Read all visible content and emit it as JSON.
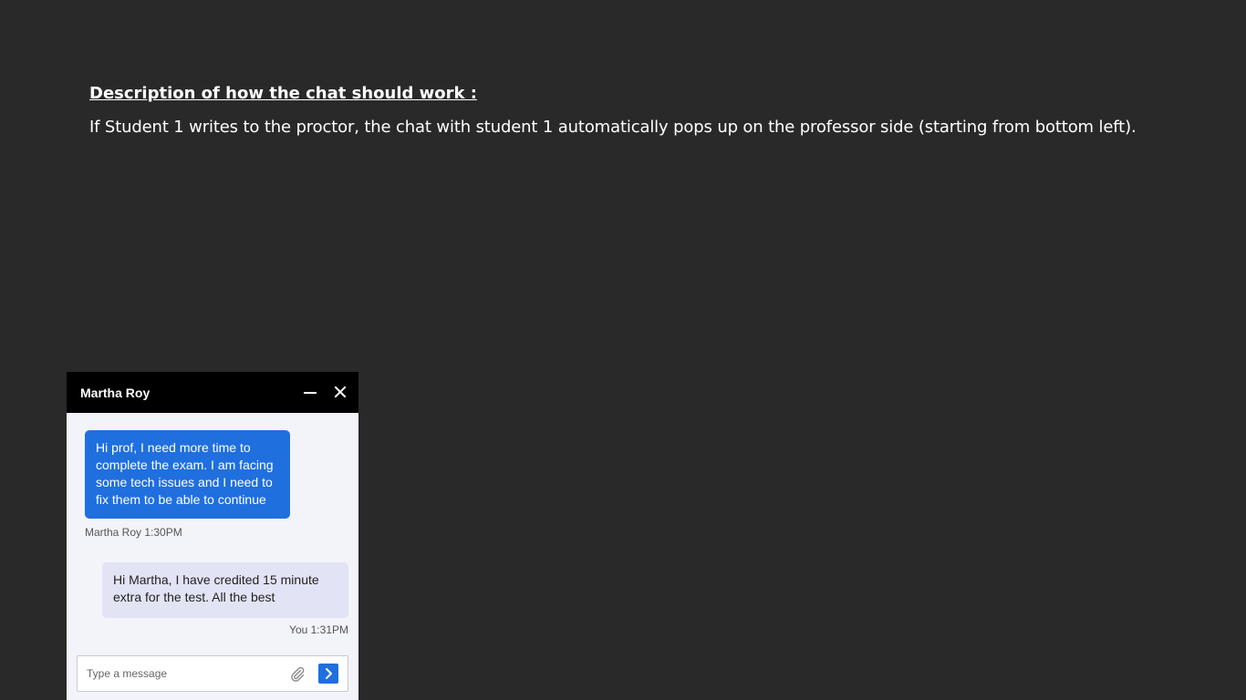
{
  "description": {
    "title": "Description of how the chat should work :",
    "body": "If Student 1 writes to the proctor, the chat with student 1 automatically pops up on the professor side (starting from bottom left)."
  },
  "chat": {
    "contact_name": "Martha Roy",
    "icons": {
      "minimize": "minimize-icon",
      "close": "close-icon",
      "attach": "paperclip-icon",
      "send": "chevron-right-icon"
    },
    "colors": {
      "header_bg": "#000000",
      "incoming_bubble": "#1f6fde",
      "outgoing_bubble": "#e2e4f6",
      "panel_bg": "#f3f3fa"
    },
    "messages": [
      {
        "direction": "incoming",
        "text": "Hi prof, I need more time to complete the exam. I am facing some tech issues and I need to fix them to be able to continue",
        "meta": "Martha Roy 1:30PM"
      },
      {
        "direction": "outgoing",
        "text": "Hi Martha, I have credited 15 minute extra for the test. All the best",
        "meta": "You 1:31PM"
      }
    ],
    "composer": {
      "placeholder": "Type a message",
      "value": ""
    }
  }
}
